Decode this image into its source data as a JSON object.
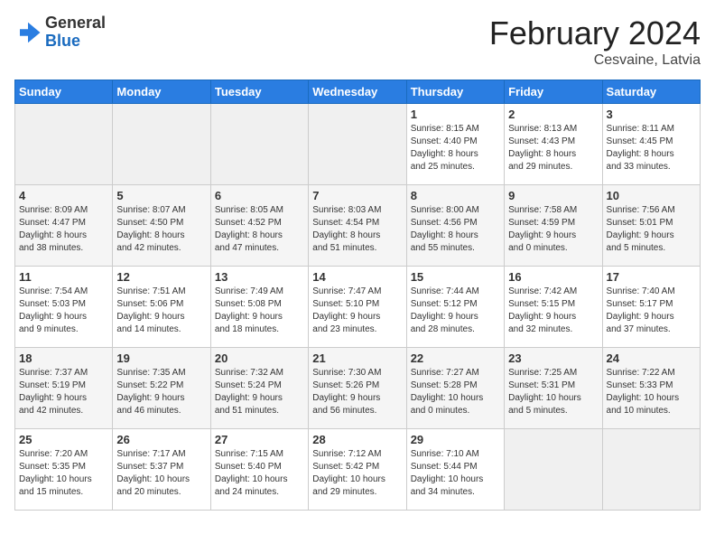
{
  "logo": {
    "general": "General",
    "blue": "Blue"
  },
  "header": {
    "title": "February 2024",
    "subtitle": "Cesvaine, Latvia"
  },
  "weekdays": [
    "Sunday",
    "Monday",
    "Tuesday",
    "Wednesday",
    "Thursday",
    "Friday",
    "Saturday"
  ],
  "weeks": [
    [
      {
        "day": "",
        "info": ""
      },
      {
        "day": "",
        "info": ""
      },
      {
        "day": "",
        "info": ""
      },
      {
        "day": "",
        "info": ""
      },
      {
        "day": "1",
        "info": "Sunrise: 8:15 AM\nSunset: 4:40 PM\nDaylight: 8 hours\nand 25 minutes."
      },
      {
        "day": "2",
        "info": "Sunrise: 8:13 AM\nSunset: 4:43 PM\nDaylight: 8 hours\nand 29 minutes."
      },
      {
        "day": "3",
        "info": "Sunrise: 8:11 AM\nSunset: 4:45 PM\nDaylight: 8 hours\nand 33 minutes."
      }
    ],
    [
      {
        "day": "4",
        "info": "Sunrise: 8:09 AM\nSunset: 4:47 PM\nDaylight: 8 hours\nand 38 minutes."
      },
      {
        "day": "5",
        "info": "Sunrise: 8:07 AM\nSunset: 4:50 PM\nDaylight: 8 hours\nand 42 minutes."
      },
      {
        "day": "6",
        "info": "Sunrise: 8:05 AM\nSunset: 4:52 PM\nDaylight: 8 hours\nand 47 minutes."
      },
      {
        "day": "7",
        "info": "Sunrise: 8:03 AM\nSunset: 4:54 PM\nDaylight: 8 hours\nand 51 minutes."
      },
      {
        "day": "8",
        "info": "Sunrise: 8:00 AM\nSunset: 4:56 PM\nDaylight: 8 hours\nand 55 minutes."
      },
      {
        "day": "9",
        "info": "Sunrise: 7:58 AM\nSunset: 4:59 PM\nDaylight: 9 hours\nand 0 minutes."
      },
      {
        "day": "10",
        "info": "Sunrise: 7:56 AM\nSunset: 5:01 PM\nDaylight: 9 hours\nand 5 minutes."
      }
    ],
    [
      {
        "day": "11",
        "info": "Sunrise: 7:54 AM\nSunset: 5:03 PM\nDaylight: 9 hours\nand 9 minutes."
      },
      {
        "day": "12",
        "info": "Sunrise: 7:51 AM\nSunset: 5:06 PM\nDaylight: 9 hours\nand 14 minutes."
      },
      {
        "day": "13",
        "info": "Sunrise: 7:49 AM\nSunset: 5:08 PM\nDaylight: 9 hours\nand 18 minutes."
      },
      {
        "day": "14",
        "info": "Sunrise: 7:47 AM\nSunset: 5:10 PM\nDaylight: 9 hours\nand 23 minutes."
      },
      {
        "day": "15",
        "info": "Sunrise: 7:44 AM\nSunset: 5:12 PM\nDaylight: 9 hours\nand 28 minutes."
      },
      {
        "day": "16",
        "info": "Sunrise: 7:42 AM\nSunset: 5:15 PM\nDaylight: 9 hours\nand 32 minutes."
      },
      {
        "day": "17",
        "info": "Sunrise: 7:40 AM\nSunset: 5:17 PM\nDaylight: 9 hours\nand 37 minutes."
      }
    ],
    [
      {
        "day": "18",
        "info": "Sunrise: 7:37 AM\nSunset: 5:19 PM\nDaylight: 9 hours\nand 42 minutes."
      },
      {
        "day": "19",
        "info": "Sunrise: 7:35 AM\nSunset: 5:22 PM\nDaylight: 9 hours\nand 46 minutes."
      },
      {
        "day": "20",
        "info": "Sunrise: 7:32 AM\nSunset: 5:24 PM\nDaylight: 9 hours\nand 51 minutes."
      },
      {
        "day": "21",
        "info": "Sunrise: 7:30 AM\nSunset: 5:26 PM\nDaylight: 9 hours\nand 56 minutes."
      },
      {
        "day": "22",
        "info": "Sunrise: 7:27 AM\nSunset: 5:28 PM\nDaylight: 10 hours\nand 0 minutes."
      },
      {
        "day": "23",
        "info": "Sunrise: 7:25 AM\nSunset: 5:31 PM\nDaylight: 10 hours\nand 5 minutes."
      },
      {
        "day": "24",
        "info": "Sunrise: 7:22 AM\nSunset: 5:33 PM\nDaylight: 10 hours\nand 10 minutes."
      }
    ],
    [
      {
        "day": "25",
        "info": "Sunrise: 7:20 AM\nSunset: 5:35 PM\nDaylight: 10 hours\nand 15 minutes."
      },
      {
        "day": "26",
        "info": "Sunrise: 7:17 AM\nSunset: 5:37 PM\nDaylight: 10 hours\nand 20 minutes."
      },
      {
        "day": "27",
        "info": "Sunrise: 7:15 AM\nSunset: 5:40 PM\nDaylight: 10 hours\nand 24 minutes."
      },
      {
        "day": "28",
        "info": "Sunrise: 7:12 AM\nSunset: 5:42 PM\nDaylight: 10 hours\nand 29 minutes."
      },
      {
        "day": "29",
        "info": "Sunrise: 7:10 AM\nSunset: 5:44 PM\nDaylight: 10 hours\nand 34 minutes."
      },
      {
        "day": "",
        "info": ""
      },
      {
        "day": "",
        "info": ""
      }
    ]
  ]
}
